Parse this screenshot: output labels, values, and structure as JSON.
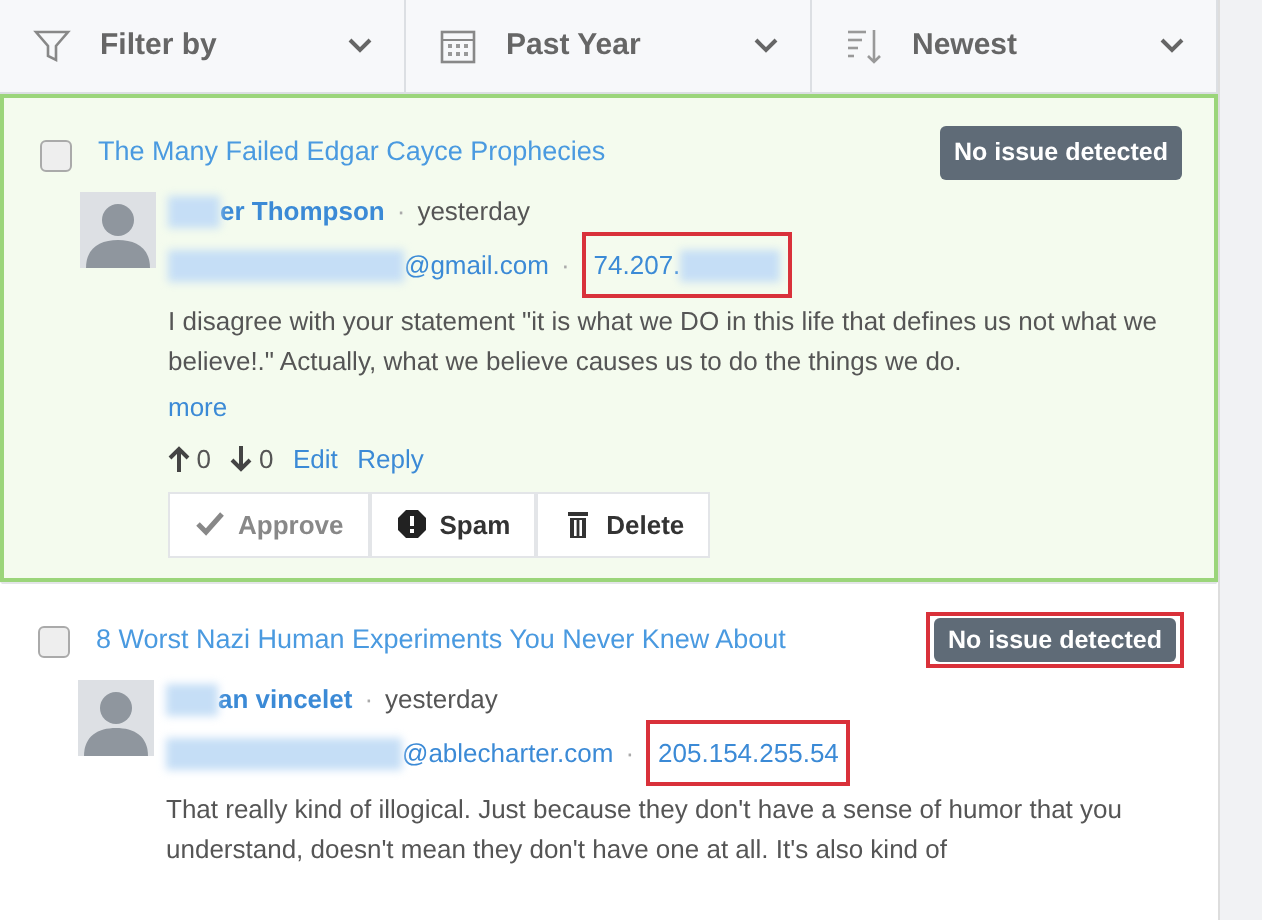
{
  "separator": "·",
  "filters": [
    {
      "kind": "filter",
      "label": "Filter by"
    },
    {
      "kind": "calendar",
      "label": "Past Year"
    },
    {
      "kind": "sort",
      "label": "Newest"
    }
  ],
  "comments": [
    {
      "selected": true,
      "checked": false,
      "title": "The Many Failed Edgar Cayce Prophecies",
      "status": "No issue detected",
      "status_marked": false,
      "author": "er Thompson",
      "author_blurred": true,
      "time": "yesterday",
      "email": "@gmail.com",
      "email_blurred": true,
      "ip": "74.207.",
      "ip_blurred": true,
      "ip_marked": true,
      "body": "I disagree with your statement \"it is what we DO in this life that defines us not what we believe!.\" Actually, what we believe causes us to do the things we do.",
      "more": "more",
      "up": "0",
      "down": "0",
      "links": [
        "Edit",
        "Reply"
      ],
      "actions": [
        {
          "kind": "approve",
          "label": "Approve"
        },
        {
          "kind": "spam",
          "label": "Spam"
        },
        {
          "kind": "delete",
          "label": "Delete"
        }
      ]
    },
    {
      "selected": false,
      "checked": false,
      "title": "8 Worst Nazi Human Experiments You Never Knew About",
      "status": "No issue detected",
      "status_marked": true,
      "author": "an vincelet",
      "author_blurred": true,
      "time": "yesterday",
      "email": "@ablecharter.com",
      "email_blurred": true,
      "ip": "205.154.255.54",
      "ip_blurred": false,
      "ip_marked": true,
      "body": "That really kind of illogical. Just because they don't have a sense of humor that you understand, doesn't mean they don't have one at all. It's also kind of"
    }
  ]
}
